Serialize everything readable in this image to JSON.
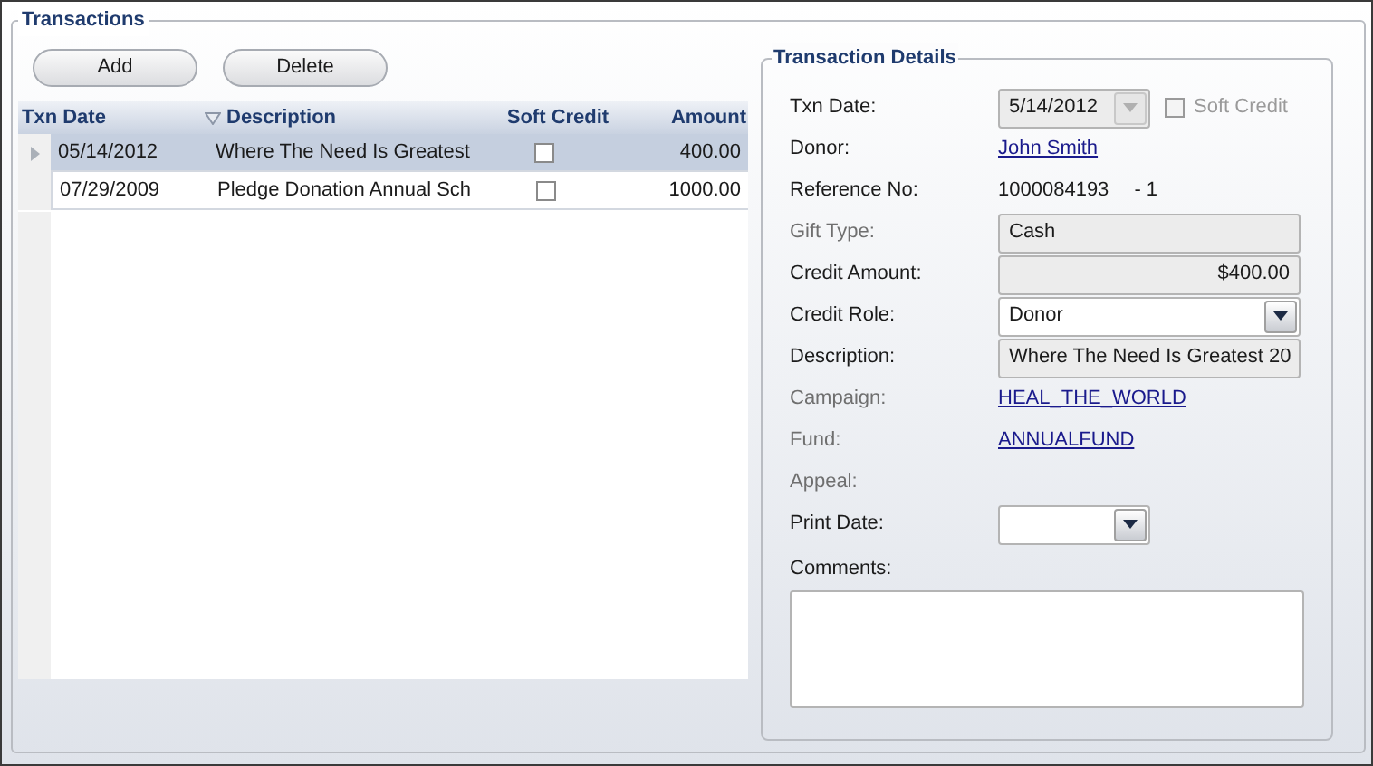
{
  "transactions": {
    "title": "Transactions",
    "buttons": [
      "Add",
      "Delete"
    ],
    "columns": [
      {
        "label": "Txn Date",
        "sorted": false
      },
      {
        "label": "Description",
        "sorted": true
      },
      {
        "label": "Soft Credit",
        "sorted": false
      },
      {
        "label": "Amount",
        "sorted": false
      }
    ],
    "rows": [
      {
        "date": "05/14/2012",
        "description": "Where The Need Is Greatest",
        "soft_credit": false,
        "amount": "400.00",
        "selected": true
      },
      {
        "date": "07/29/2009",
        "description": "Pledge Donation Annual Sch",
        "soft_credit": false,
        "amount": "1000.00",
        "selected": false
      }
    ]
  },
  "details": {
    "title": "Transaction Details",
    "fields": [
      {
        "kind": "date",
        "label": "Txn Date:",
        "label_disabled": false,
        "value": "5/14/2012",
        "disabled": true,
        "checkbox": {
          "label": "Soft Credit",
          "checked": false
        }
      },
      {
        "kind": "link",
        "label": "Donor:",
        "label_disabled": false,
        "value": "John Smith"
      },
      {
        "kind": "text",
        "label": "Reference No:",
        "label_disabled": false,
        "value": "1000084193",
        "suffix": "- 1"
      },
      {
        "kind": "readonly",
        "label": "Gift Type:",
        "label_disabled": true,
        "value": "Cash"
      },
      {
        "kind": "readonly-right",
        "label": "Credit Amount:",
        "label_disabled": false,
        "value": "$400.00"
      },
      {
        "kind": "dropdown",
        "label": "Credit Role:",
        "label_disabled": false,
        "value": "Donor"
      },
      {
        "kind": "readonly",
        "label": "Description:",
        "label_disabled": false,
        "value": "Where The Need Is Greatest 20"
      },
      {
        "kind": "link",
        "label": "Campaign:",
        "label_disabled": true,
        "value": "HEAL_THE_WORLD"
      },
      {
        "kind": "link",
        "label": "Fund:",
        "label_disabled": true,
        "value": "ANNUALFUND"
      },
      {
        "kind": "empty",
        "label": "Appeal:",
        "label_disabled": true
      },
      {
        "kind": "date",
        "label": "Print Date:",
        "label_disabled": false,
        "disabled": false
      }
    ],
    "comments": {
      "label": "Comments:"
    }
  }
}
